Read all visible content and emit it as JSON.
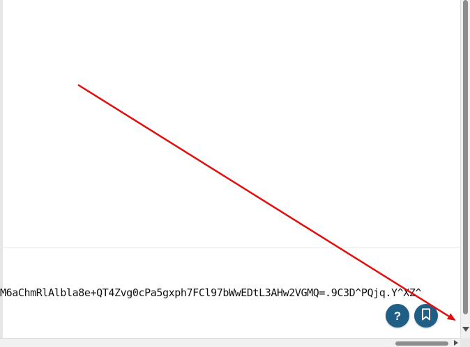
{
  "page": {
    "token_text": "M6aChmRlAlbla8e+QT4Zvg0cPa5gxph7FCl97bWwEDtL3AHw2VGMQ=.9C3D^PQjq.Y^XZ^"
  },
  "buttons": {
    "help_label": "?",
    "bookmark_icon": "bookmark-icon"
  },
  "colors": {
    "fab_background": "#1f5f86",
    "annotation_arrow": "#e01010"
  }
}
